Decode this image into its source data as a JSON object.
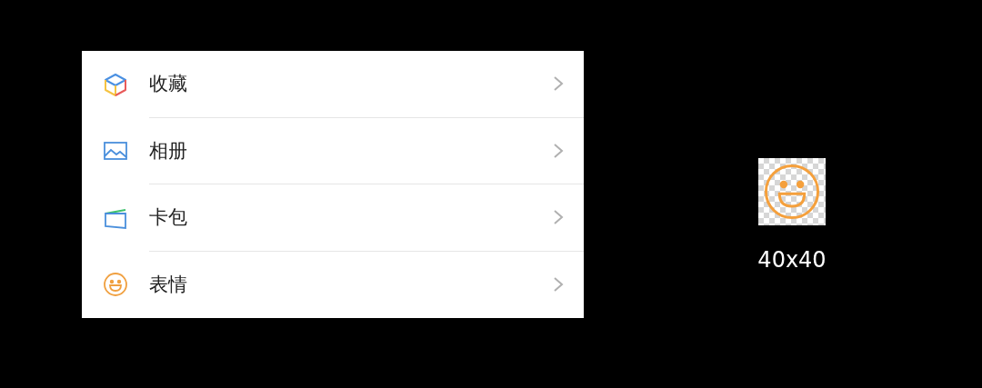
{
  "menu": {
    "items": [
      {
        "kind": "cube",
        "label": "收藏"
      },
      {
        "kind": "photo",
        "label": "相册"
      },
      {
        "kind": "card",
        "label": "卡包"
      },
      {
        "kind": "smile",
        "label": "表情"
      }
    ]
  },
  "preview": {
    "caption": "40x40"
  }
}
